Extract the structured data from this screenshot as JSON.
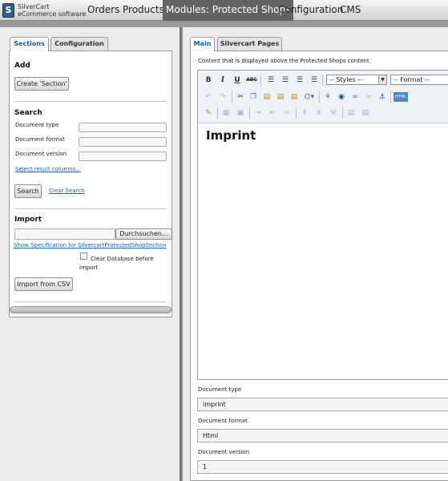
{
  "nav": {
    "logo_line1": "SilverCart",
    "logo_line2": "eCommerce software",
    "items": [
      "Orders",
      "Products",
      "Modules: Protected Shops",
      "Configuration",
      "CMS"
    ]
  },
  "left": {
    "tabs": [
      "Sections",
      "Configuration"
    ],
    "add_heading": "Add",
    "create_button": "Create 'Section'",
    "search_heading": "Search",
    "search_fields": [
      "Document type",
      "Document format",
      "Document version"
    ],
    "select_columns_link": "Select result columns...",
    "search_button": "Search",
    "clear_search_link": "Clear Search",
    "import_heading": "Import",
    "browse_button": "Durchsuchen...",
    "spec_link": "Show Specification for SilvercartProtectedShopSection",
    "clear_db_line1": "Clear Database before",
    "clear_db_line2": "import",
    "import_button": "Import from CSV"
  },
  "right": {
    "tabs": [
      "Main",
      "Silvercart Pages"
    ],
    "content_label": "Content that is displayed above the Protected Shops content",
    "editor": {
      "styles_select": "-- Styles --",
      "format_select": "-- Format --",
      "content_heading": "Imprint"
    },
    "fields": [
      {
        "label": "Document type",
        "value": "imprint"
      },
      {
        "label": "Document format",
        "value": "Html"
      },
      {
        "label": "Document version",
        "value": "1"
      }
    ]
  },
  "icons": {
    "toolbar_row1": [
      "bold-icon",
      "italic-icon",
      "underline-icon",
      "strikethrough-icon",
      "align-left-icon",
      "align-center-icon",
      "align-right-icon",
      "align-justify-icon"
    ],
    "toolbar_row2": [
      "undo-icon",
      "redo-icon",
      "cut-icon",
      "copy-icon",
      "paste-icon",
      "paste-text-icon",
      "paste-word-icon",
      "insert-image-icon",
      "flash-icon",
      "link-icon",
      "unlink-icon",
      "anchor-icon",
      "html-icon"
    ],
    "toolbar_row3": [
      "cleanup-icon",
      "table-icon",
      "table-properties-icon",
      "insert-row-icon",
      "delete-row-icon",
      "split-cell-icon",
      "insert-col-icon",
      "delete-col-icon",
      "merge-cells-icon",
      "grid-icon",
      "grid2-icon"
    ]
  },
  "colors": {
    "nav_active": "#636363",
    "tab_active_text": "#1b5aa6",
    "link": "#1a63b0"
  }
}
